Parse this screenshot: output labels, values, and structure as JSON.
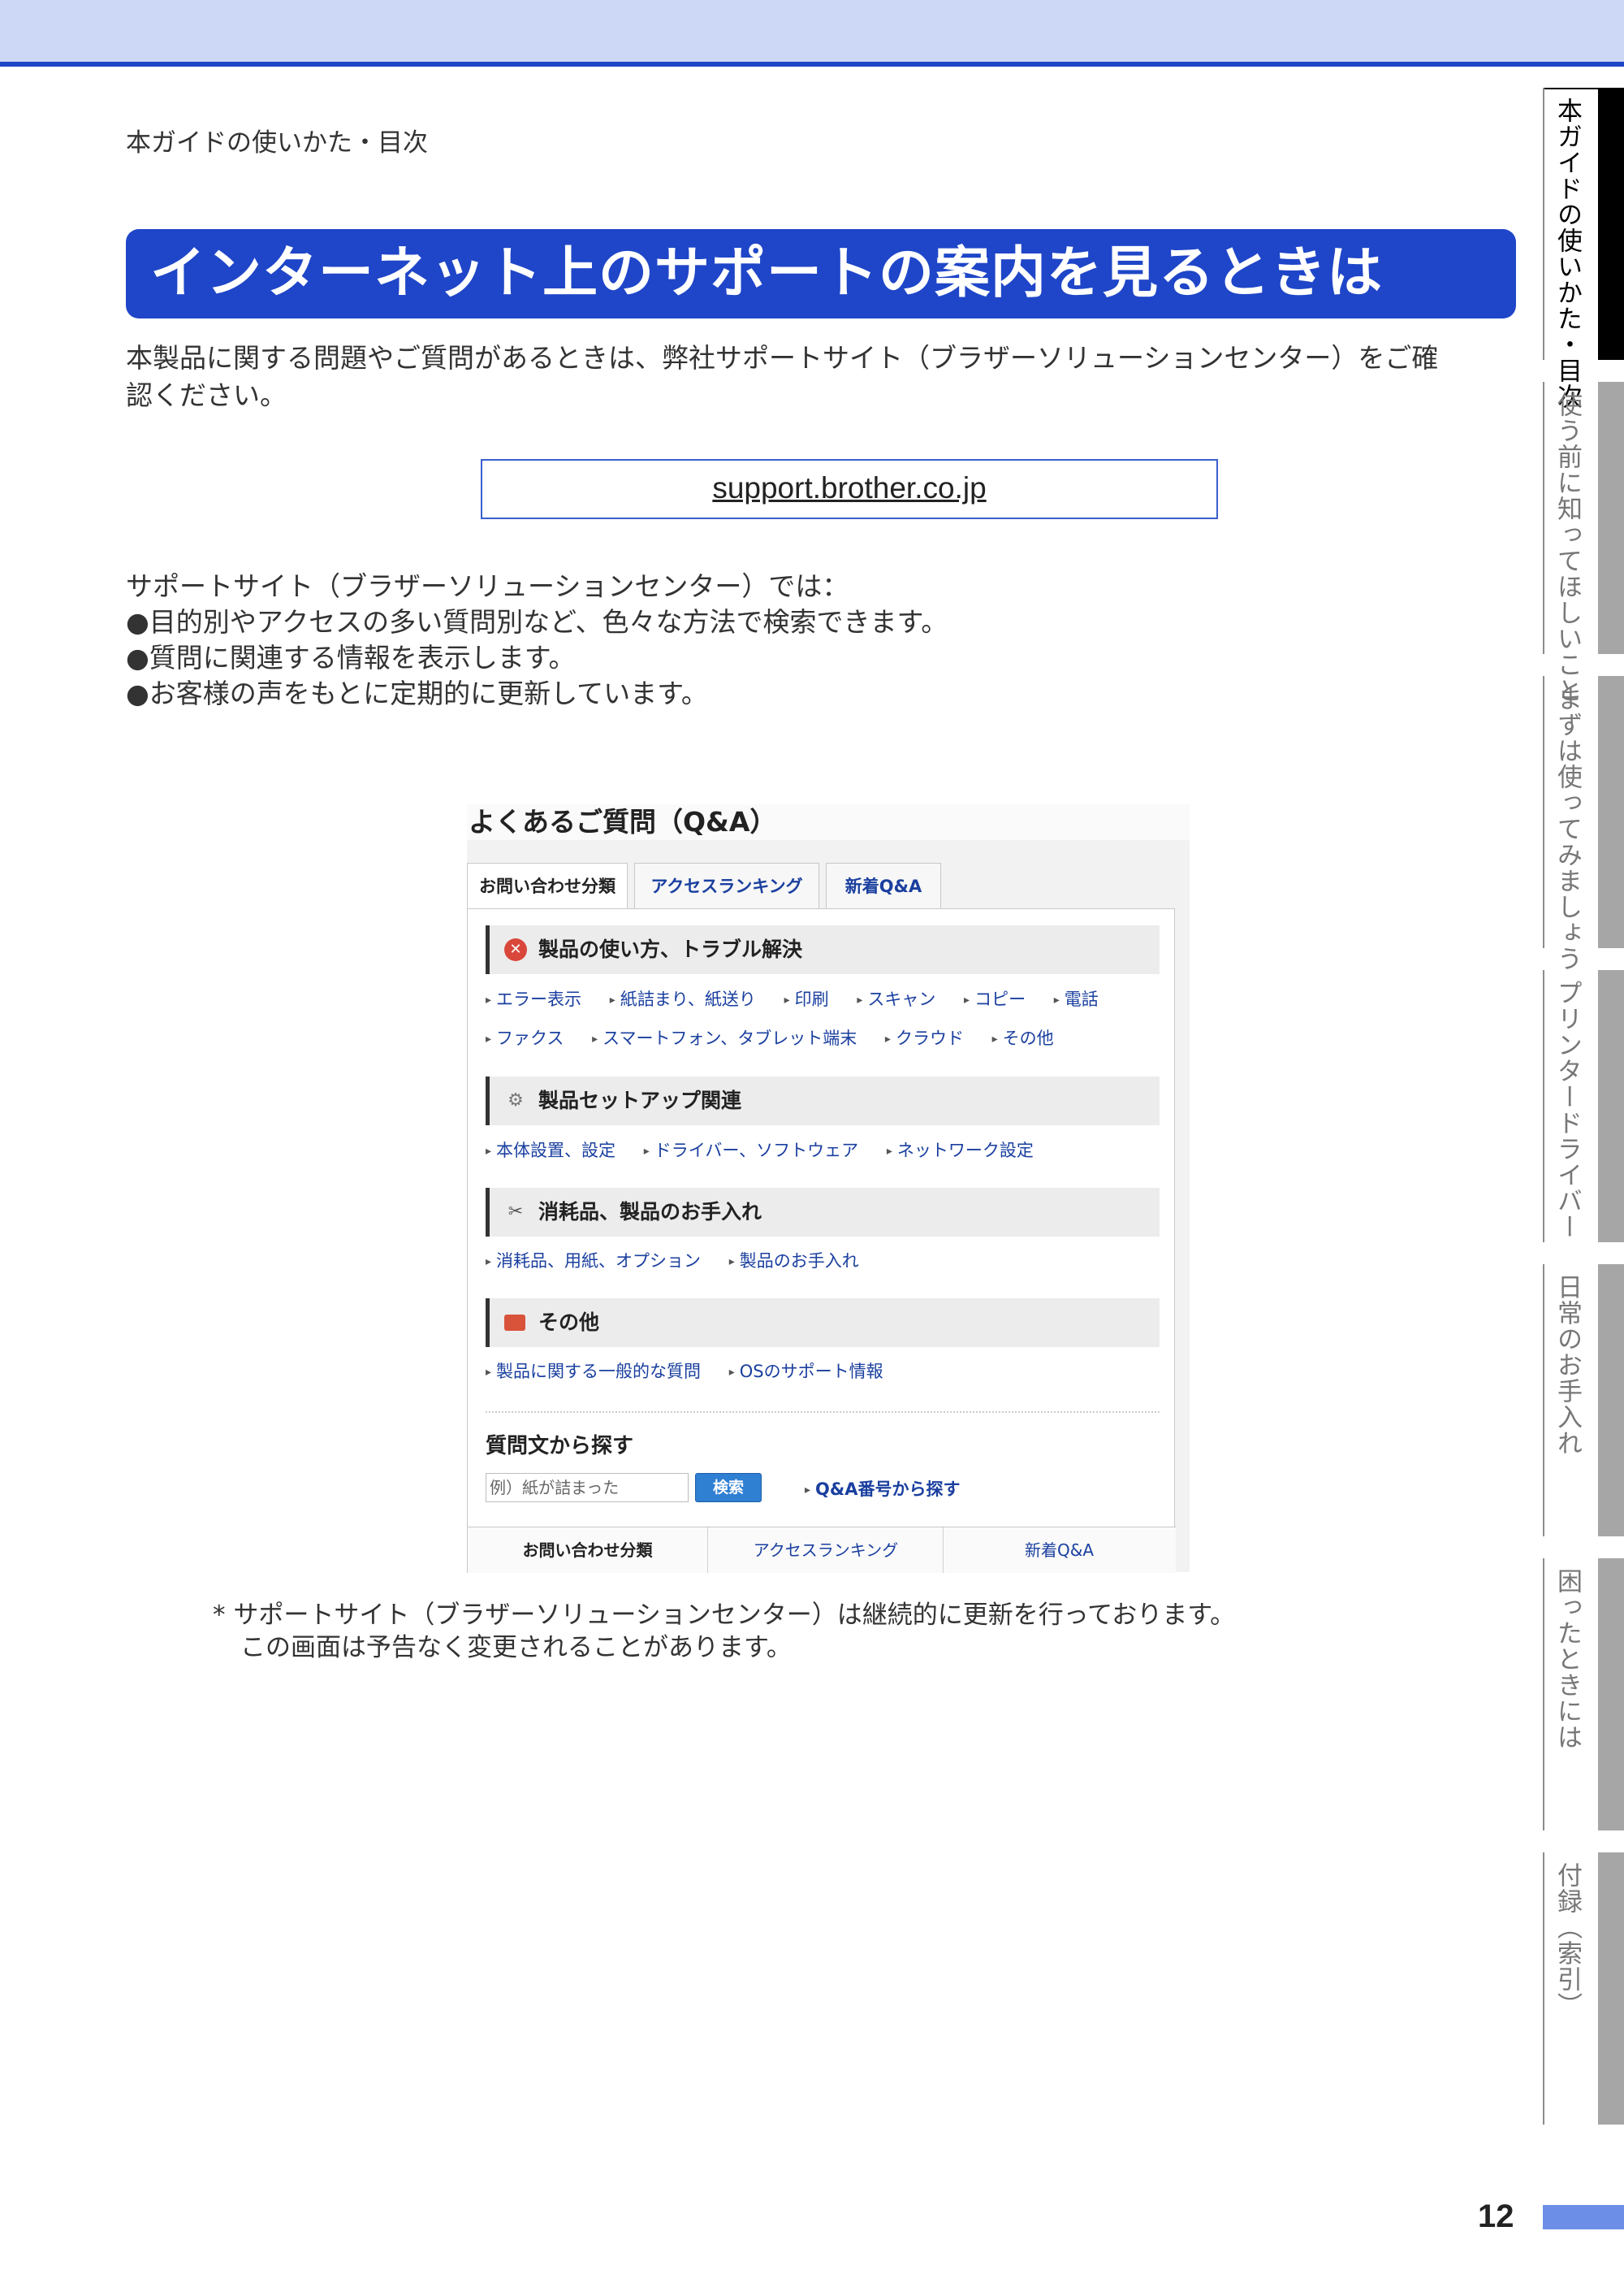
{
  "breadcrumb": "本ガイドの使いかた・目次",
  "page_title": "インターネット上のサポートの案内を見るときは",
  "intro_text_line1": "本製品に関する問題やご質問があるときは、弊社サポートサイト（ブラザーソリューションセンター）をご確",
  "intro_text_line2": "認ください。",
  "support_url": "support.brother.co.jp",
  "features": {
    "heading": "サポートサイト（ブラザーソリューションセンター）では：",
    "items": [
      "●目的別やアクセスの多い質問別など、色々な方法で検索できます。",
      "●質問に関連する情報を表示します。",
      "●お客様の声をもとに定期的に更新しています。"
    ]
  },
  "qa_screenshot": {
    "title": "よくあるご質問（Q&A）",
    "tabs": [
      "お問い合わせ分類",
      "アクセスランキング",
      "新着Q&A"
    ],
    "sections": [
      {
        "heading": "製品の使い方、トラブル解決",
        "icon": "error-icon",
        "rows": [
          [
            "エラー表示",
            "紙詰まり、紙送り",
            "印刷",
            "スキャン",
            "コピー",
            "電話"
          ],
          [
            "ファクス",
            "スマートフォン、タブレット端末",
            "クラウド",
            "その他"
          ]
        ]
      },
      {
        "heading": "製品セットアップ関連",
        "icon": "gear-icon",
        "rows": [
          [
            "本体設置、設定",
            "ドライバー、ソフトウェア",
            "ネットワーク設定"
          ]
        ]
      },
      {
        "heading": "消耗品、製品のお手入れ",
        "icon": "tools-icon",
        "rows": [
          [
            "消耗品、用紙、オプション",
            "製品のお手入れ"
          ]
        ]
      },
      {
        "heading": "その他",
        "icon": "toolbox-icon",
        "rows": [
          [
            "製品に関する一般的な質問",
            "OSのサポート情報"
          ]
        ]
      }
    ],
    "search": {
      "title": "質問文から探す",
      "placeholder": "例）紙が詰まった",
      "button": "検索",
      "qa_number_link": "Q&A番号から探す"
    },
    "bottom_tabs": [
      "お問い合わせ分類",
      "アクセスランキング",
      "新着Q&A"
    ]
  },
  "footnote_line1": "*  サポートサイト（ブラザーソリューションセンター）は継続的に更新を行っております。",
  "footnote_line2": "この画面は予告なく変更されることがあります。",
  "side_tabs": [
    "本ガイドの使いかた・目次",
    "使う前に知ってほしいこと",
    "まずは使ってみましょう",
    "プリンタードライバー",
    "日常のお手入れ",
    "困ったときには",
    "付録（索引）"
  ],
  "page_number": "12",
  "colors": {
    "accent": "#1f46c8",
    "top_bar": "#cdd7f6",
    "link": "#1a3f9f",
    "page_bar": "#6c8ee6"
  }
}
